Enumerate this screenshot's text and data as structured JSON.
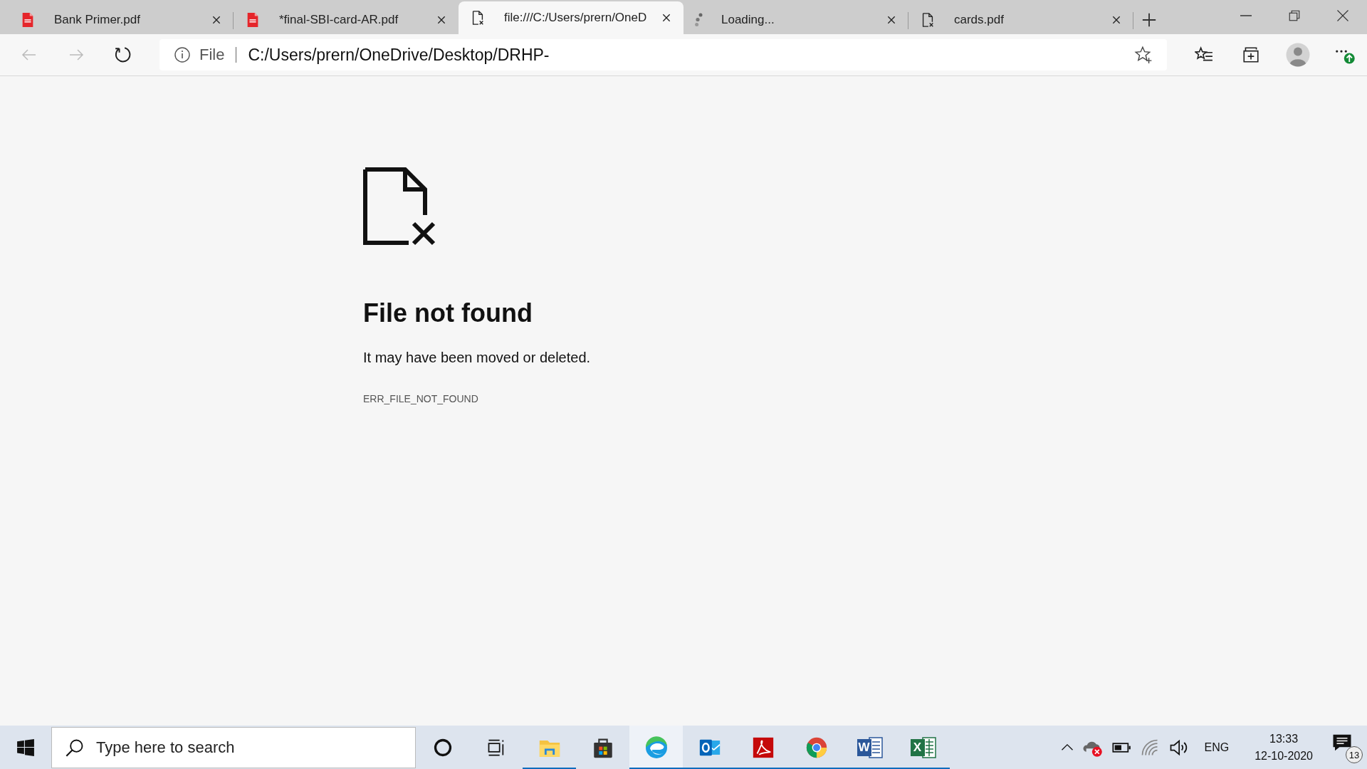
{
  "tabs": [
    {
      "title": "Bank Primer.pdf",
      "kind": "pdf",
      "selected": false
    },
    {
      "title": "*final-SBI-card-AR.pdf",
      "kind": "pdf",
      "selected": false
    },
    {
      "title": "file:///C:/Users/prern/OneD",
      "kind": "file",
      "selected": true
    },
    {
      "title": "Loading...",
      "kind": "loading",
      "selected": false
    },
    {
      "title": "cards.pdf",
      "kind": "file",
      "selected": false
    }
  ],
  "address_bar": {
    "scheme": "File",
    "url": "C:/Users/prern/OneDrive/Desktop/DRHP-"
  },
  "error_page": {
    "title": "File not found",
    "message": "It may have been moved or deleted.",
    "code": "ERR_FILE_NOT_FOUND"
  },
  "taskbar": {
    "search_placeholder": "Type here to search",
    "apps": [
      {
        "kind": "explorer",
        "running": true,
        "selected": false
      },
      {
        "kind": "store",
        "running": false,
        "selected": false
      },
      {
        "kind": "edge",
        "running": true,
        "selected": true
      },
      {
        "kind": "outlook",
        "running": true,
        "selected": false
      },
      {
        "kind": "acrobat",
        "running": true,
        "selected": false
      },
      {
        "kind": "chrome",
        "running": true,
        "selected": false
      },
      {
        "kind": "word",
        "letter": "W",
        "running": true,
        "selected": false
      },
      {
        "kind": "excel",
        "letter": "X",
        "running": true,
        "selected": false
      }
    ],
    "language": "ENG",
    "time": "13:33",
    "date": "12-10-2020",
    "notifications": "13"
  }
}
